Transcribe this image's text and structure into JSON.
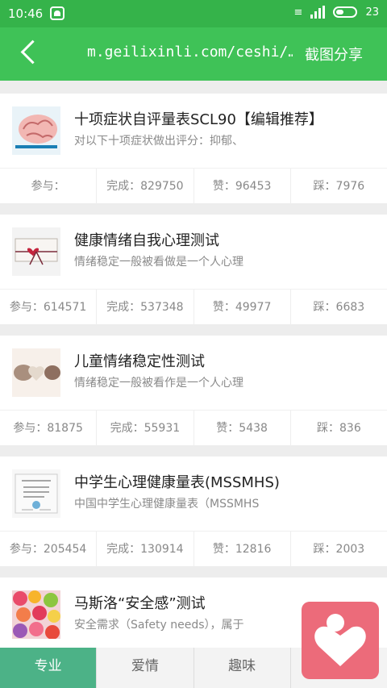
{
  "status": {
    "time": "10:46",
    "battery": "23"
  },
  "header": {
    "url": "m.geilixinli.com/ceshi/…",
    "share": "截图分享"
  },
  "cards": [
    {
      "title": "十项症状自评量表SCL90【编辑推荐】",
      "desc": "对以下十项症状做出评分：抑郁、",
      "joined": "参与：",
      "done": "完成：829750",
      "likes": "赞：96453",
      "dislikes": "踩：7976"
    },
    {
      "title": "健康情绪自我心理测试",
      "desc": "情绪稳定一般被看做是一个人心理",
      "joined": "参与：614571",
      "done": "完成：537348",
      "likes": "赞：49977",
      "dislikes": "踩：6683"
    },
    {
      "title": "儿童情绪稳定性测试",
      "desc": "情绪稳定一般被看作是一个人心理",
      "joined": "参与：81875",
      "done": "完成：55931",
      "likes": "赞：5438",
      "dislikes": "踩：836"
    },
    {
      "title": "中学生心理健康量表(MSSMHS)",
      "desc": "中国中学生心理健康量表（MSSMHS",
      "joined": "参与：205454",
      "done": "完成：130914",
      "likes": "赞：12816",
      "dislikes": "踩：2003"
    },
    {
      "title": "马斯洛“安全感”测试",
      "desc": "安全需求（Safety needs），属于"
    }
  ],
  "tabs": [
    "专业",
    "爱情",
    "趣味"
  ],
  "colors": {
    "statusbar": "#35b34a",
    "topbar": "#3fc257",
    "active_tab": "#4cb287",
    "fab": "#ec6b7a"
  }
}
